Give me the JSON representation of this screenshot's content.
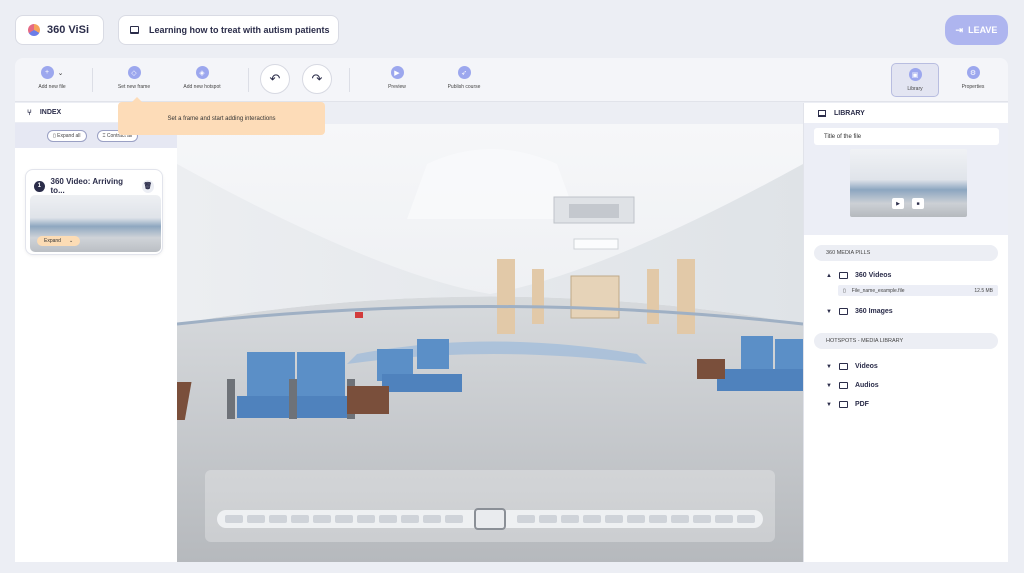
{
  "header": {
    "brand": "360 ViSi",
    "course_title": "Learning how to treat with autism patients",
    "leave_label": "LEAVE"
  },
  "toolbar": {
    "add_new_file": "Add new file",
    "set_new_frame": "Set new frame",
    "add_new_hotspot": "Add new hotspot",
    "preview": "Preview",
    "publish_course": "Publish course",
    "library": "Library",
    "properties": "Properties"
  },
  "tooltip": "Set a frame and start adding interactions",
  "index": {
    "title": "INDEX",
    "expand_all": "Expand all",
    "contract_all": "Contract all",
    "card": {
      "number": "1",
      "title": "360 Video: Arriving to...",
      "expand_label": "Expand"
    }
  },
  "library": {
    "title": "LIBRARY",
    "file_title": "Title of the file",
    "section1": "360 MEDIA PILLS",
    "folders1": [
      "360 Videos",
      "360 Images"
    ],
    "file": {
      "name": "File_name_example.file",
      "size": "12.5 MB"
    },
    "section2": "HOTSPOTS - MEDIA LIBRARY",
    "folders2": [
      "Videos",
      "Audios",
      "PDF"
    ]
  },
  "colors": {
    "accent": "#9ca7ee",
    "leave": "#aeb5ef",
    "tooltip": "#fddcb8",
    "dark": "#2b2d4a"
  }
}
